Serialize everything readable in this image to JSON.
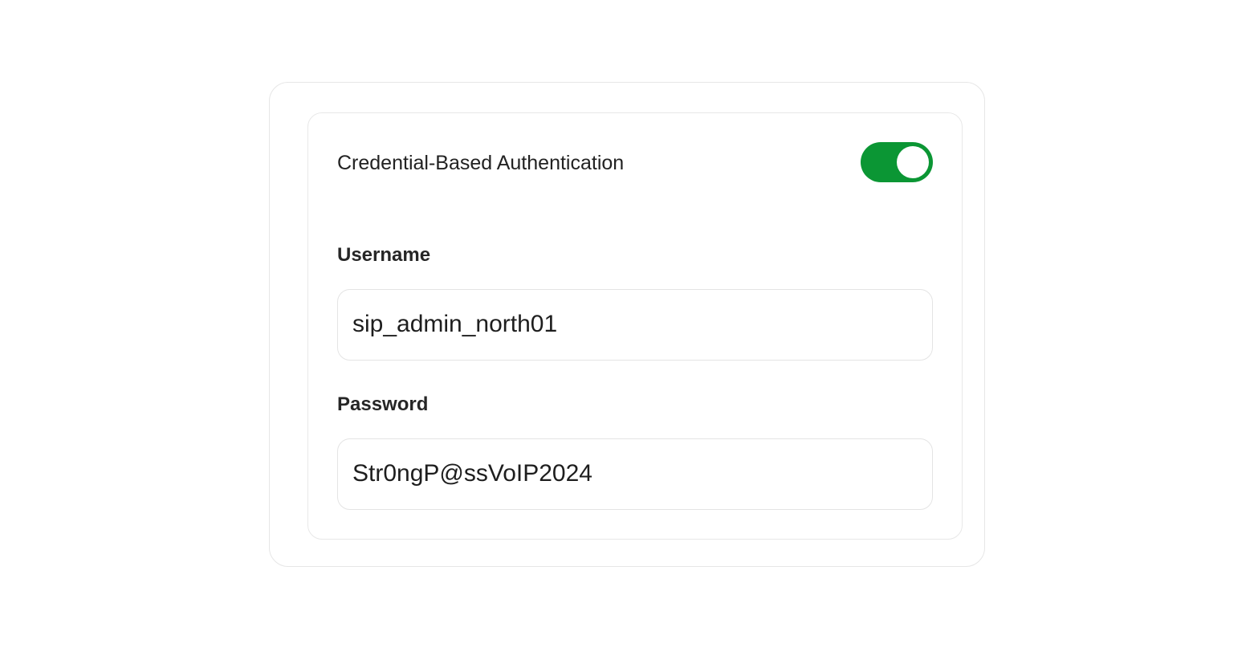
{
  "auth": {
    "toggle_label": "Credential-Based Authentication",
    "toggle_on": true,
    "toggle_color": "#0b9634"
  },
  "username": {
    "label": "Username",
    "value": "sip_admin_north01"
  },
  "password": {
    "label": "Password",
    "value": "Str0ngP@ssVoIP2024"
  }
}
